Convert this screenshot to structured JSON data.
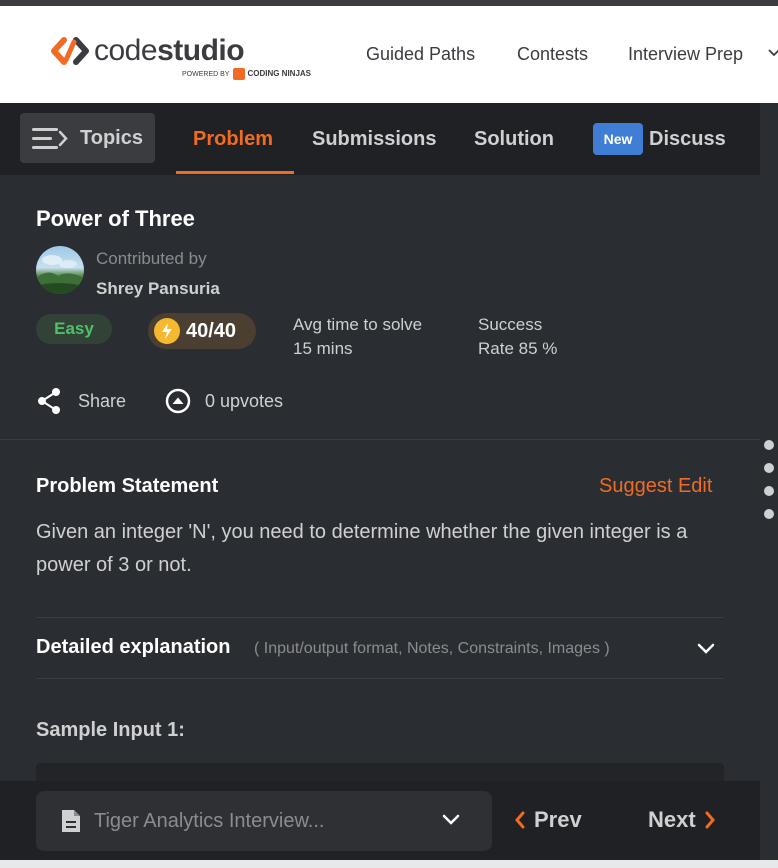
{
  "header": {
    "logo": {
      "main_light": "code",
      "main_bold": "studio",
      "powered_by": "POWERED BY",
      "partner": "CODING NINJAS"
    },
    "nav": [
      {
        "label": "Guided Paths"
      },
      {
        "label": "Contests"
      },
      {
        "label": "Interview Prep"
      }
    ]
  },
  "tabs": {
    "topics_label": "Topics",
    "items": [
      {
        "label": "Problem",
        "active": true
      },
      {
        "label": "Submissions"
      },
      {
        "label": "Solution"
      },
      {
        "label": "Discuss",
        "badge": "New"
      }
    ]
  },
  "problem": {
    "title": "Power of Three",
    "contributed_label": "Contributed by",
    "contributor": "Shrey Pansuria",
    "difficulty": "Easy",
    "score": "40/40",
    "avg_time_label": "Avg time to solve",
    "avg_time_value": "15 mins",
    "success_label": "Success",
    "success_value": "Rate 85 %",
    "share_label": "Share",
    "upvotes_label": "0 upvotes"
  },
  "statement": {
    "title": "Problem Statement",
    "suggest_edit": "Suggest Edit",
    "body": "Given an integer 'N', you need to determine whether the given integer is a power of 3 or not.",
    "detail_title": "Detailed explanation",
    "detail_sub": "( Input/output format, Notes, Constraints, Images )",
    "sample_title": "Sample Input 1:"
  },
  "footer": {
    "dropdown_value": "Tiger Analytics Interview...",
    "prev_label": "Prev",
    "next_label": "Next"
  },
  "colors": {
    "accent": "#f26b24",
    "background": "#2a2d31",
    "tabbar": "#1f2124",
    "easy_green": "#4fbf6a",
    "badge_blue": "#3f7ed4"
  },
  "icons": [
    "topics-menu-icon",
    "share-icon",
    "upvote-icon",
    "chevron-down-icon",
    "document-icon",
    "chevron-left-icon",
    "chevron-right-icon",
    "bolt-icon"
  ]
}
